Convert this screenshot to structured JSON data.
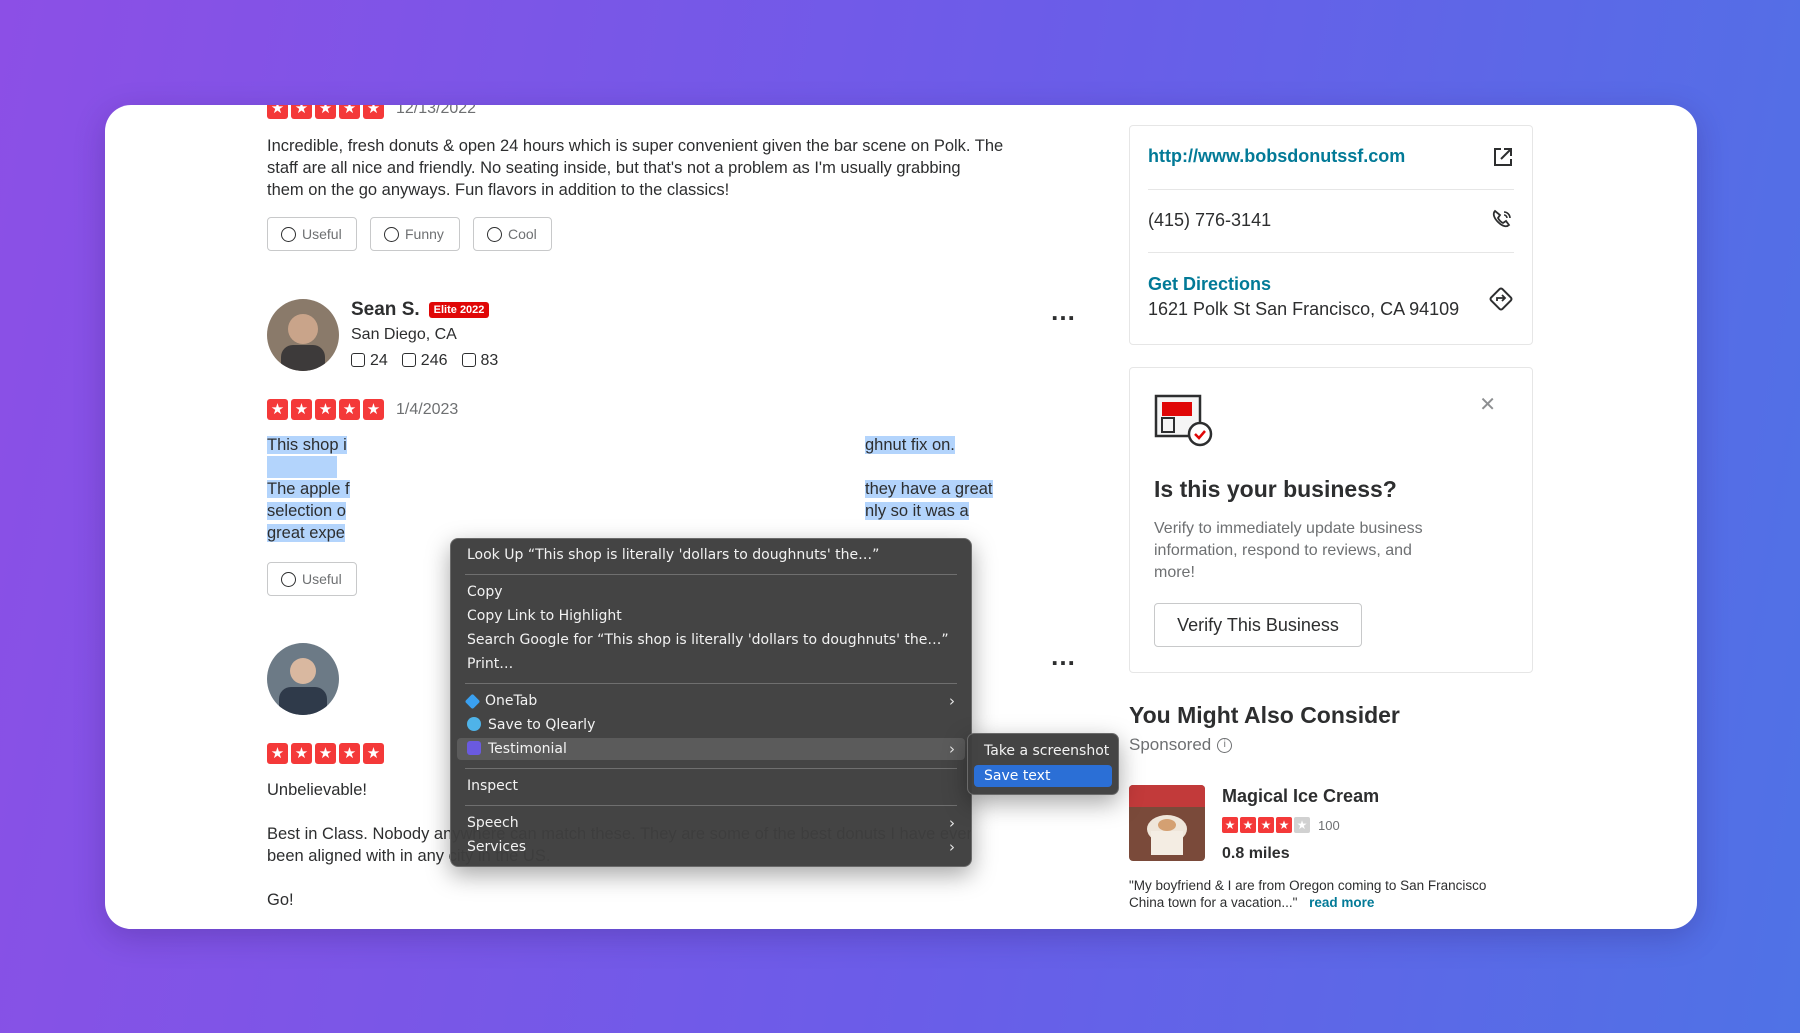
{
  "review1": {
    "stars": 5,
    "date": "12/13/2022",
    "text_lines": [
      "Incredible, fresh donuts & open 24 hours which is super convenient given the bar scene on Polk. The",
      "staff are all nice and friendly. No seating inside, but that's not a problem as I'm usually grabbing",
      "them on the go anyways. Fun flavors in addition to the classics!"
    ],
    "reactions": {
      "useful": "Useful",
      "funny": "Funny",
      "cool": "Cool"
    }
  },
  "review2": {
    "name": "Sean S.",
    "elite": "Elite 2022",
    "location": "San Diego, CA",
    "friends": "24",
    "reviews": "246",
    "photos": "83",
    "stars": 5,
    "date": "1/4/2023",
    "line1_start": "This shop i",
    "line1_end": "ghnut fix on.",
    "line2_start": "The apple f",
    "line2_end": "they have a great",
    "line3_start": "selection o",
    "line3_end": "nly so it was a",
    "line4_start": "great expe",
    "useful": "Useful",
    "more": "…"
  },
  "review3": {
    "stars": 5,
    "title": "Unbelievable!",
    "body_lines": [
      "Best in Class. Nobody anywhere can match these.  They are some of the best donuts I have ever",
      "been aligned with in any city in the US."
    ],
    "closing": "Go!",
    "more": "…"
  },
  "context_menu": {
    "lookup": "Look Up “This shop is literally 'dollars to doughnuts' the…”",
    "copy": "Copy",
    "copy_link": "Copy Link to Highlight",
    "search_google": "Search Google for “This shop is literally 'dollars to doughnuts' the…”",
    "print": "Print…",
    "onetab": "OneTab",
    "qlearly": "Save to Qlearly",
    "testimonial": "Testimonial",
    "inspect": "Inspect",
    "speech": "Speech",
    "services": "Services",
    "chevron": "›"
  },
  "submenu": {
    "screenshot": "Take a screenshot",
    "save_text": "Save text"
  },
  "sidebar": {
    "website": "http://www.bobsdonutssf.com",
    "phone": "(415) 776-3141",
    "directions_label": "Get Directions",
    "address": "1621 Polk St San Francisco, CA 94109",
    "claim": {
      "title": "Is this your business?",
      "desc_lines": [
        "Verify to immediately update business",
        "information, respond to reviews, and",
        "more!"
      ],
      "button": "Verify This Business",
      "close": "✕"
    },
    "consider": {
      "title": "You Might Also Consider",
      "sponsored": "Sponsored",
      "biz_name": "Magical Ice Cream",
      "stars": 4,
      "review_count": "100",
      "distance": "0.8 miles",
      "quote_lines": [
        "\"My boyfriend & I are from Oregon coming to San Francisco",
        "China town for a vacation...\""
      ],
      "read_more": "read more"
    }
  },
  "colors": {
    "star_red": "#f43939",
    "link_teal": "#027a97",
    "elite_red": "#e00707",
    "selection_blue": "#b3d4fc",
    "menu_active_blue": "#2b6fd6"
  }
}
